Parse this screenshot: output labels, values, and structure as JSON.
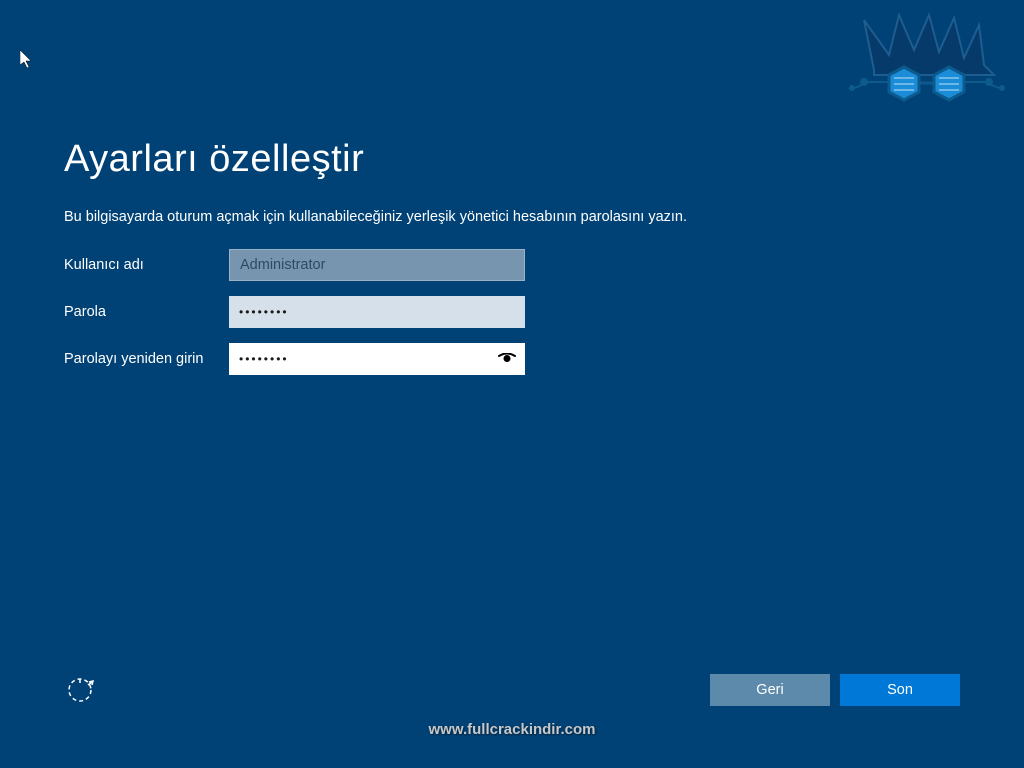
{
  "page": {
    "title": "Ayarları özelleştir",
    "description": "Bu bilgisayarda oturum açmak için kullanabileceğiniz yerleşik yönetici hesabının parolasını yazın."
  },
  "form": {
    "username_label": "Kullanıcı adı",
    "username_value": "Administrator",
    "password_label": "Parola",
    "password_value": "••••••••",
    "confirm_label": "Parolayı yeniden girin",
    "confirm_value": "••••••••"
  },
  "buttons": {
    "back": "Geri",
    "finish": "Son"
  },
  "watermark": "www.fullcrackindir.com"
}
